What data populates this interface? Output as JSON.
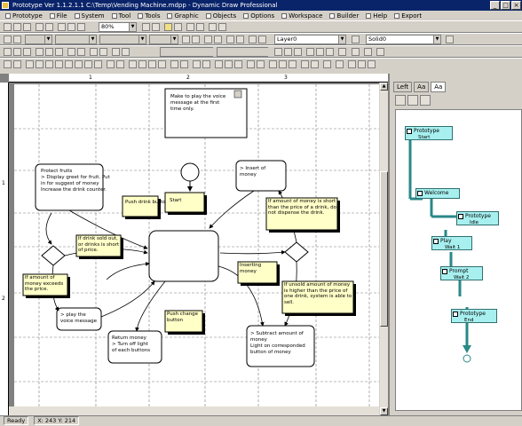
{
  "window": {
    "title": "Prototype Ver 1.1.2.1.1 C:\\Temp\\Vending Machine.mdpp - Dynamic Draw Professional",
    "controls": [
      "_",
      "□",
      "×"
    ]
  },
  "menu": {
    "items": [
      {
        "label": "Prototype",
        "icon": "prototype-icon"
      },
      {
        "label": "File",
        "icon": "file-icon"
      },
      {
        "label": "System",
        "icon": "system-icon"
      },
      {
        "label": "Tool",
        "icon": "tool-icon"
      },
      {
        "label": "Tools",
        "icon": "tools-icon"
      },
      {
        "label": "Graphic",
        "icon": "graphic-icon"
      },
      {
        "label": "Objects",
        "icon": "objects-icon"
      },
      {
        "label": "Options",
        "icon": "options-icon"
      },
      {
        "label": "Workspace",
        "icon": "workspace-icon"
      },
      {
        "label": "Builder",
        "icon": "builder-icon"
      },
      {
        "label": "Help",
        "icon": "help-icon"
      },
      {
        "label": "Export",
        "icon": "export-icon"
      }
    ]
  },
  "toolbar": {
    "zoom_value": "80%",
    "layer_value": "Layer0",
    "style_value": "Solid0"
  },
  "sidebar": {
    "tabs": [
      "Left",
      "Aa",
      "Aa"
    ],
    "active_tab": 2,
    "nodes": [
      {
        "label": "Prototype",
        "sub": "Start"
      },
      {
        "label": "Welcome",
        "sub": ""
      },
      {
        "label": "Prototype",
        "sub": "Idle"
      },
      {
        "label": "Play",
        "sub": "Wait 1"
      },
      {
        "label": "Prompt",
        "sub": "Wait 2"
      },
      {
        "label": "Prototype",
        "sub": "End"
      }
    ]
  },
  "diagram": {
    "title_note": "Make to play the voice message at the first time only.",
    "start_label": "Start",
    "states": [
      {
        "name": "protect-state",
        "lines": [
          "Protect fruits",
          "> Display greet for fruit. Put",
          "  in for suggest of money",
          "  Increase the drink counter."
        ]
      },
      {
        "name": "center-state",
        "lines": []
      },
      {
        "name": "insert-money-state",
        "lines": [
          "> Insert of",
          "  money"
        ]
      },
      {
        "name": "play-voice-state",
        "lines": [
          "> play the",
          "  voice message"
        ]
      },
      {
        "name": "return-money-state",
        "lines": [
          "Return money",
          "> Turn off light",
          "  of each buttons"
        ]
      },
      {
        "name": "subtract-money-state",
        "lines": [
          "> Subtract amount of",
          "  money",
          "  Light on corresponded",
          "  button of money"
        ]
      }
    ],
    "notes": [
      "Push drink button",
      "Start",
      "If amount of money is short than the price of a drink, do not dispense the drink.",
      "If drink sold out, or drinks is short of price.",
      "If amount of money exceeds the price.",
      "Inserting money",
      "If unsold amount of money is higher than the price of one drink, system is able to sell.",
      "Push change button"
    ]
  },
  "status": {
    "text": "Ready",
    "coords": "X: 243 Y: 214"
  }
}
